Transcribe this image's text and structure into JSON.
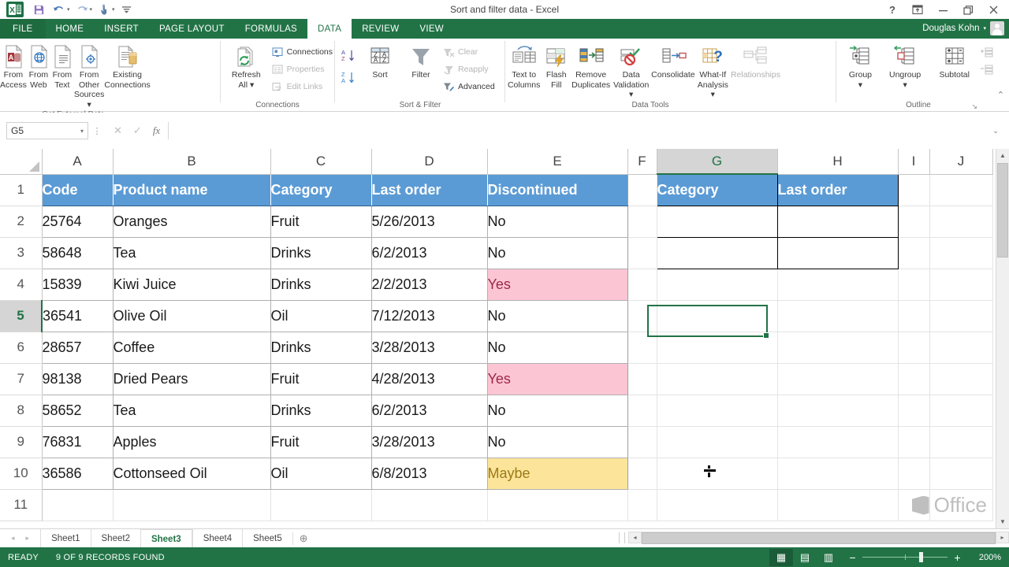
{
  "window": {
    "title": "Sort and filter data - Excel",
    "user": "Douglas Kohn",
    "help_icon": "?",
    "ribbon_display_icon": "ribbon-display-options",
    "minimize_icon": "—",
    "restore_icon": "❐",
    "close_icon": "✕"
  },
  "quick_access": {
    "excel_logo": "X",
    "save": "save-icon",
    "undo": "undo-icon",
    "redo": "redo-icon",
    "touch": "touch-mode-icon",
    "more": "customize-qat-icon"
  },
  "ribbon_tabs": [
    {
      "label": "FILE",
      "active": false,
      "file": true
    },
    {
      "label": "HOME",
      "active": false
    },
    {
      "label": "INSERT",
      "active": false
    },
    {
      "label": "PAGE LAYOUT",
      "active": false
    },
    {
      "label": "FORMULAS",
      "active": false
    },
    {
      "label": "DATA",
      "active": true
    },
    {
      "label": "REVIEW",
      "active": false
    },
    {
      "label": "VIEW",
      "active": false
    }
  ],
  "ribbon": {
    "groups": [
      {
        "name": "Get External Data",
        "label": "Get External Data",
        "buttons": [
          {
            "label": "From\nAccess",
            "line1": "From",
            "line2": "Access",
            "icon": "from-access-icon"
          },
          {
            "label": "From\nWeb",
            "line1": "From",
            "line2": "Web",
            "icon": "from-web-icon"
          },
          {
            "label": "From\nText",
            "line1": "From",
            "line2": "Text",
            "icon": "from-text-icon"
          },
          {
            "label": "From Other\nSources",
            "line1": "From Other",
            "line2": "Sources ▾",
            "icon": "from-other-sources-icon"
          },
          {
            "label": "Existing\nConnections",
            "line1": "Existing",
            "line2": "Connections",
            "icon": "existing-connections-icon"
          }
        ]
      },
      {
        "name": "Connections",
        "label": "Connections",
        "big": {
          "line1": "Refresh",
          "line2": "All ▾",
          "icon": "refresh-all-icon"
        },
        "small": [
          {
            "label": "Connections",
            "icon": "connections-icon",
            "disabled": false
          },
          {
            "label": "Properties",
            "icon": "properties-icon",
            "disabled": true
          },
          {
            "label": "Edit Links",
            "icon": "edit-links-icon",
            "disabled": true
          }
        ]
      },
      {
        "name": "Sort & Filter",
        "label": "Sort & Filter",
        "sort_az": "sort-ascending-icon",
        "sort_za": "sort-descending-icon",
        "buttons": [
          {
            "label": "Sort",
            "icon": "sort-dialog-icon"
          },
          {
            "label": "Filter",
            "icon": "filter-icon"
          }
        ],
        "small": [
          {
            "label": "Clear",
            "icon": "clear-filter-icon",
            "disabled": true
          },
          {
            "label": "Reapply",
            "icon": "reapply-icon",
            "disabled": true
          },
          {
            "label": "Advanced",
            "icon": "advanced-filter-icon",
            "disabled": false
          }
        ]
      },
      {
        "name": "Data Tools",
        "label": "Data Tools",
        "buttons": [
          {
            "line1": "Text to",
            "line2": "Columns",
            "icon": "text-to-columns-icon"
          },
          {
            "line1": "Flash",
            "line2": "Fill",
            "icon": "flash-fill-icon"
          },
          {
            "line1": "Remove",
            "line2": "Duplicates",
            "icon": "remove-duplicates-icon"
          },
          {
            "line1": "Data",
            "line2": "Validation ▾",
            "icon": "data-validation-icon"
          },
          {
            "line1": "Consolidate",
            "line2": "",
            "icon": "consolidate-icon"
          },
          {
            "line1": "What-If",
            "line2": "Analysis ▾",
            "icon": "what-if-analysis-icon"
          },
          {
            "line1": "Relationships",
            "line2": "",
            "icon": "relationships-icon",
            "disabled": true
          }
        ]
      },
      {
        "name": "Outline",
        "label": "Outline",
        "buttons": [
          {
            "line1": "Group",
            "line2": "▾",
            "icon": "group-icon"
          },
          {
            "line1": "Ungroup",
            "line2": "▾",
            "icon": "ungroup-icon"
          },
          {
            "line1": "Subtotal",
            "line2": "",
            "icon": "subtotal-icon"
          }
        ],
        "small": [
          {
            "label": "",
            "icon": "show-detail-icon",
            "disabled": true
          },
          {
            "label": "",
            "icon": "hide-detail-icon",
            "disabled": true
          }
        ],
        "dialog_launcher": "↘"
      }
    ],
    "collapse_icon": "⌃"
  },
  "formula_bar": {
    "name_box_value": "G5",
    "name_box_caret": "▾",
    "cancel_icon": "✕",
    "enter_icon": "✓",
    "function_icon": "fx",
    "formula_value": "",
    "expand_icon": "⌄"
  },
  "grid": {
    "column_headers": [
      "A",
      "B",
      "C",
      "D",
      "E",
      "F",
      "G",
      "H",
      "I",
      "J"
    ],
    "selected_column": "G",
    "row_headers": [
      "1",
      "2",
      "3",
      "4",
      "5",
      "6",
      "7",
      "8",
      "9",
      "10",
      "11"
    ],
    "selected_row": "5",
    "active_cell": "G5",
    "table1": {
      "headers": [
        "Code",
        "Product name",
        "Category",
        "Last order",
        "Discontinued"
      ],
      "rows": [
        {
          "code": "25764",
          "product": "Oranges",
          "category": "Fruit",
          "last_order": "5/26/2013",
          "discontinued": "No",
          "fill": "none"
        },
        {
          "code": "58648",
          "product": "Tea",
          "category": "Drinks",
          "last_order": "6/2/2013",
          "discontinued": "No",
          "fill": "none"
        },
        {
          "code": "15839",
          "product": "Kiwi Juice",
          "category": "Drinks",
          "last_order": "2/2/2013",
          "discontinued": "Yes",
          "fill": "pink"
        },
        {
          "code": "36541",
          "product": "Olive Oil",
          "category": "Oil",
          "last_order": "7/12/2013",
          "discontinued": "No",
          "fill": "none"
        },
        {
          "code": "28657",
          "product": "Coffee",
          "category": "Drinks",
          "last_order": "3/28/2013",
          "discontinued": "No",
          "fill": "none"
        },
        {
          "code": "98138",
          "product": "Dried Pears",
          "category": "Fruit",
          "last_order": "4/28/2013",
          "discontinued": "Yes",
          "fill": "pink"
        },
        {
          "code": "58652",
          "product": "Tea",
          "category": "Drinks",
          "last_order": "6/2/2013",
          "discontinued": "No",
          "fill": "none"
        },
        {
          "code": "76831",
          "product": "Apples",
          "category": "Fruit",
          "last_order": "3/28/2013",
          "discontinued": "No",
          "fill": "none"
        },
        {
          "code": "36586",
          "product": "Cottonseed Oil",
          "category": "Oil",
          "last_order": "6/8/2013",
          "discontinued": "Maybe",
          "fill": "yellow"
        }
      ]
    },
    "criteria_range": {
      "headers": [
        "Category",
        "Last order"
      ],
      "rows": [
        {
          "category": "",
          "last_order": ""
        },
        {
          "category": "",
          "last_order": ""
        }
      ]
    },
    "watermark": "Office"
  },
  "sheet_tabs": {
    "prev_icon": "◂",
    "next_icon": "▸",
    "tabs": [
      {
        "label": "Sheet1",
        "active": false
      },
      {
        "label": "Sheet2",
        "active": false
      },
      {
        "label": "Sheet3",
        "active": true
      },
      {
        "label": "Sheet4",
        "active": false
      },
      {
        "label": "Sheet5",
        "active": false
      }
    ],
    "add_icon": "⊕"
  },
  "status_bar": {
    "state": "READY",
    "records": "9 OF 9 RECORDS FOUND",
    "views": [
      {
        "name": "normal-view-icon",
        "glyph": "▦",
        "active": true
      },
      {
        "name": "page-layout-view-icon",
        "glyph": "▤",
        "active": false
      },
      {
        "name": "page-break-view-icon",
        "glyph": "▥",
        "active": false
      }
    ],
    "zoom_out": "−",
    "zoom_in": "+",
    "zoom_level": "200%"
  },
  "colors": {
    "excel_green": "#217346",
    "header_blue": "#5b9bd5",
    "pink_fill": "#fbc5d4",
    "yellow_fill": "#fce59a",
    "selection_green": "#217346"
  }
}
